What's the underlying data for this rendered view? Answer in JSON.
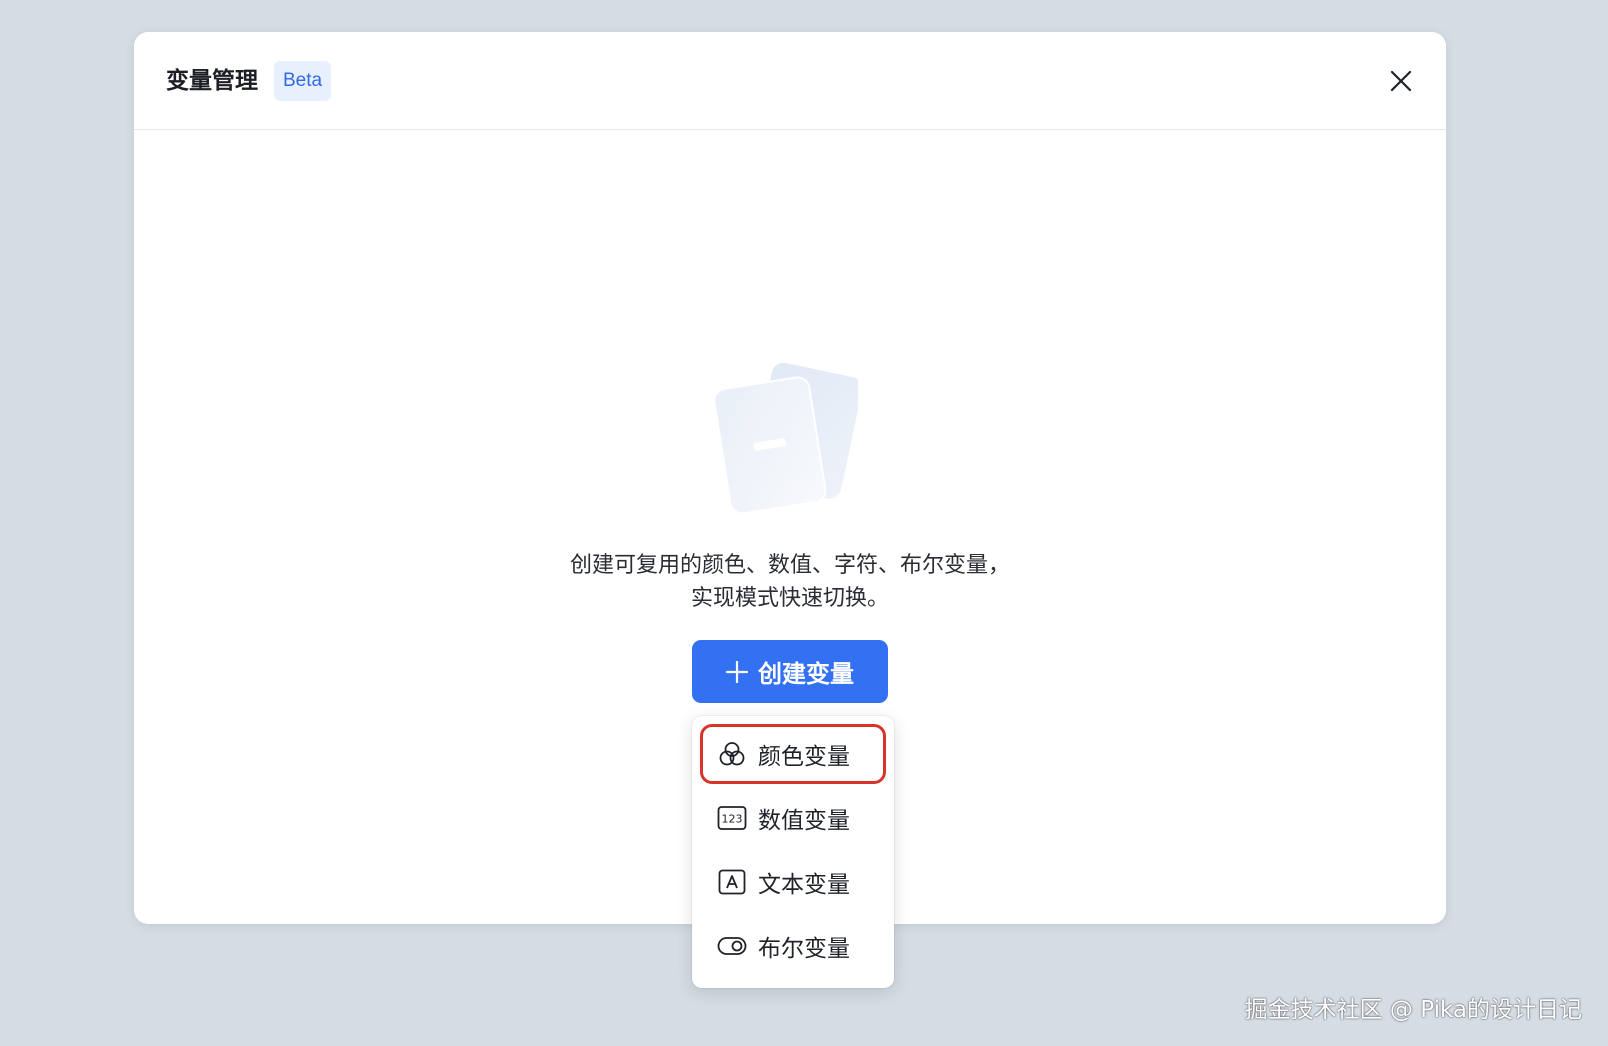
{
  "modal": {
    "title": "变量管理",
    "badge": "Beta",
    "close_icon": "close-icon"
  },
  "empty_state": {
    "illustration_icon": "stacked-cards-icon",
    "description_line1": "创建可复用的颜色、数值、字符、布尔变量，",
    "description_line2": "实现模式快速切换。"
  },
  "create_button": {
    "icon": "plus-icon",
    "label": "创建变量",
    "color": "#3470f2"
  },
  "dropdown": {
    "items": [
      {
        "icon": "color-circles-icon",
        "label": "颜色变量",
        "highlighted": true
      },
      {
        "icon": "number-123-icon",
        "label": "数值变量",
        "highlighted": false
      },
      {
        "icon": "text-a-icon",
        "label": "文本变量",
        "highlighted": false
      },
      {
        "icon": "toggle-icon",
        "label": "布尔变量",
        "highlighted": false
      }
    ],
    "highlight_color": "#d9342b"
  },
  "watermark": "掘金技术社区 @ Pika的设计日记"
}
